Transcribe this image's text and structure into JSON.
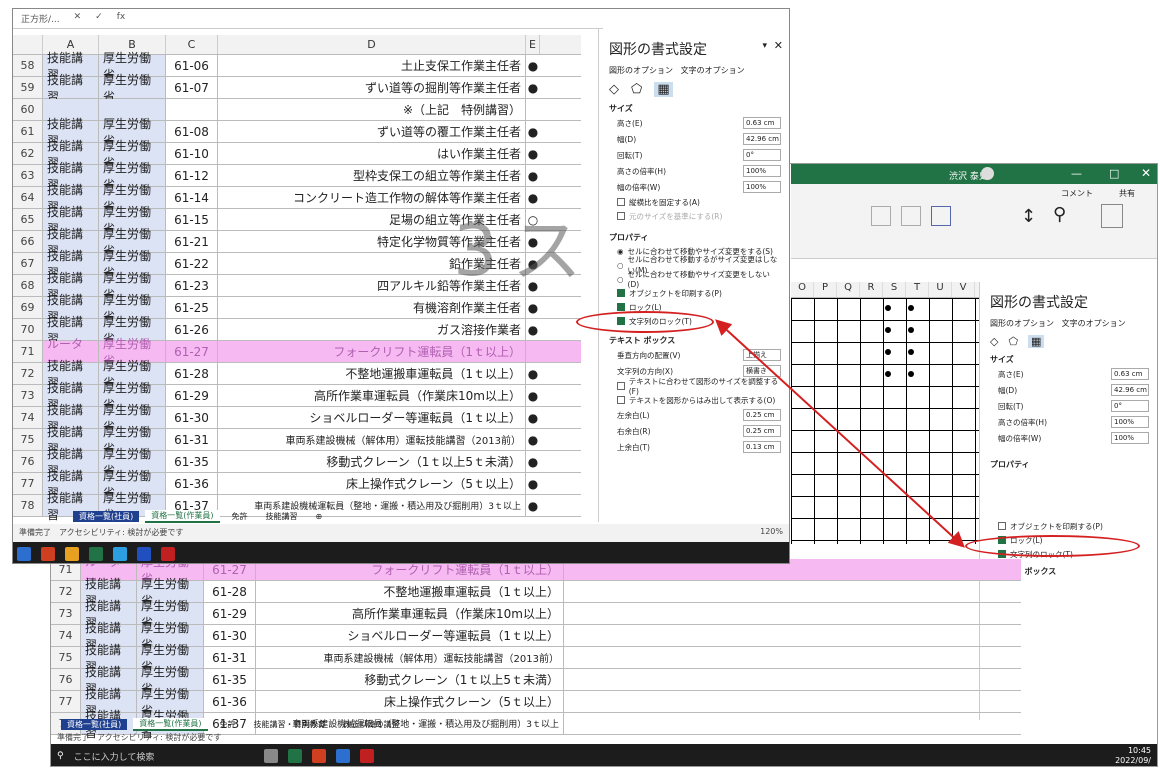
{
  "front_window": {
    "name_box": "正方形/...",
    "fx": "fx",
    "columns": [
      "A",
      "B",
      "C",
      "D",
      "E"
    ],
    "rows": [
      {
        "n": "58",
        "a": "技能講習",
        "b": "厚生労働省",
        "c": "61-06",
        "d": "土止支保工作業主任者",
        "e": "●"
      },
      {
        "n": "59",
        "a": "技能講習",
        "b": "厚生労働省",
        "c": "61-07",
        "d": "ずい道等の掘削等作業主任者",
        "e": "●"
      },
      {
        "n": "60",
        "a": "",
        "b": "",
        "c": "",
        "d": "※（上記　特例講習）",
        "e": ""
      },
      {
        "n": "61",
        "a": "技能講習",
        "b": "厚生労働省",
        "c": "61-08",
        "d": "ずい道等の覆工作業主任者",
        "e": "●"
      },
      {
        "n": "62",
        "a": "技能講習",
        "b": "厚生労働省",
        "c": "61-10",
        "d": "はい作業主任者",
        "e": "●"
      },
      {
        "n": "63",
        "a": "技能講習",
        "b": "厚生労働省",
        "c": "61-12",
        "d": "型枠支保工の組立等作業主任者",
        "e": "●"
      },
      {
        "n": "64",
        "a": "技能講習",
        "b": "厚生労働省",
        "c": "61-14",
        "d": "コンクリート造工作物の解体等作業主任者",
        "e": "●"
      },
      {
        "n": "65",
        "a": "技能講習",
        "b": "厚生労働省",
        "c": "61-15",
        "d": "足場の組立等作業主任者",
        "e": "○"
      },
      {
        "n": "66",
        "a": "技能講習",
        "b": "厚生労働省",
        "c": "61-21",
        "d": "特定化学物質等作業主任者",
        "e": "●"
      },
      {
        "n": "67",
        "a": "技能講習",
        "b": "厚生労働省",
        "c": "61-22",
        "d": "鉛作業主任者",
        "e": "●"
      },
      {
        "n": "68",
        "a": "技能講習",
        "b": "厚生労働省",
        "c": "61-23",
        "d": "四アルキル鉛等作業主任者",
        "e": "●"
      },
      {
        "n": "69",
        "a": "技能講習",
        "b": "厚生労働省",
        "c": "61-25",
        "d": "有機溶剤作業主任者",
        "e": "●"
      },
      {
        "n": "70",
        "a": "技能講習",
        "b": "厚生労働省",
        "c": "61-26",
        "d": "ガス溶接作業者",
        "e": "●"
      },
      {
        "n": "71",
        "a": "ルーター",
        "b": "厚生労働省",
        "c": "61-27",
        "d": "フォークリフト運転員（1ｔ以上）",
        "e": "",
        "pink": true
      },
      {
        "n": "72",
        "a": "技能講習",
        "b": "厚生労働省",
        "c": "61-28",
        "d": "不整地運搬車運転員（1ｔ以上）",
        "e": "●"
      },
      {
        "n": "73",
        "a": "技能講習",
        "b": "厚生労働省",
        "c": "61-29",
        "d": "高所作業車運転員（作業床10m以上）",
        "e": "●"
      },
      {
        "n": "74",
        "a": "技能講習",
        "b": "厚生労働省",
        "c": "61-30",
        "d": "ショベルローダー等運転員（1ｔ以上）",
        "e": "●"
      },
      {
        "n": "75",
        "a": "技能講習",
        "b": "厚生労働省",
        "c": "61-31",
        "d": "車両系建設機械（解体用）運転技能講習（2013前）",
        "e": "●"
      },
      {
        "n": "76",
        "a": "技能講習",
        "b": "厚生労働省",
        "c": "61-35",
        "d": "移動式クレーン（1ｔ以上5ｔ未満）",
        "e": "●"
      },
      {
        "n": "77",
        "a": "技能講習",
        "b": "厚生労働省",
        "c": "61-36",
        "d": "床上操作式クレーン（5ｔ以上）",
        "e": "●"
      },
      {
        "n": "78",
        "a": "技能講習",
        "b": "厚生労働省",
        "c": "61-37",
        "d": "車両系建設機械運転員（整地・運搬・積込用及び掘削用）3ｔ以上",
        "e": "●"
      }
    ],
    "watermark": "3 ス",
    "sheet_tabs": [
      "資格一覧(社員)",
      "資格一覧(作業員)",
      "免許",
      "技能講習",
      "⊕"
    ],
    "status": "準備完了　アクセシビリティ: 検討が必要です",
    "zoom": "120%"
  },
  "front_pane": {
    "title": "図形の書式設定",
    "tab1": "図形のオプション",
    "tab2": "文字のオプション",
    "size_section": "サイズ",
    "size_rows": [
      {
        "label": "高さ(E)",
        "value": "0.63 cm"
      },
      {
        "label": "幅(D)",
        "value": "42.96 cm"
      },
      {
        "label": "回転(T)",
        "value": "0°"
      },
      {
        "label": "高さの倍率(H)",
        "value": "100%"
      },
      {
        "label": "幅の倍率(W)",
        "value": "100%"
      }
    ],
    "lock_ratio": "縦横比を固定する(A)",
    "orig_size": "元のサイズを基準にする(R)",
    "prop_section": "プロパティ",
    "prop_options": [
      "セルに合わせて移動やサイズ変更をする(S)",
      "セルに合わせて移動するがサイズ変更はしない(M)",
      "セルに合わせて移動やサイズ変更をしない(D)"
    ],
    "print_obj": "オブジェクトを印刷する(P)",
    "lock": "ロック(L)",
    "lock_text": "文字列のロック(T)",
    "textbox_section": "テキスト ボックス",
    "tb_rows": [
      {
        "label": "垂直方向の配置(V)",
        "value": "上揃え"
      },
      {
        "label": "文字列の方向(X)",
        "value": "横書き"
      }
    ],
    "tb_chk1": "テキストに合わせて図形のサイズを調整する(F)",
    "tb_chk2": "テキストを図形からはみ出して表示する(O)",
    "margins": [
      {
        "label": "左余白(L)",
        "value": "0.25 cm"
      },
      {
        "label": "右余白(R)",
        "value": "0.25 cm"
      },
      {
        "label": "上余白(T)",
        "value": "0.13 cm"
      }
    ]
  },
  "back_window": {
    "user": "渋沢 泰史",
    "share": "共有",
    "comment": "コメント",
    "columns": [
      "O",
      "P",
      "Q",
      "R",
      "S",
      "T",
      "U",
      "V"
    ],
    "rows": [
      {
        "n": "71",
        "a": "ルーター",
        "b": "厚生労働省",
        "c": "61-27",
        "d": "フォークリフト運転員（1ｔ以上）",
        "pink": true
      },
      {
        "n": "72",
        "a": "技能講習",
        "b": "厚生労働省",
        "c": "61-28",
        "d": "不整地運搬車運転員（1ｔ以上）"
      },
      {
        "n": "73",
        "a": "技能講習",
        "b": "厚生労働省",
        "c": "61-29",
        "d": "高所作業車運転員（作業床10m以上）"
      },
      {
        "n": "74",
        "a": "技能講習",
        "b": "厚生労働省",
        "c": "61-30",
        "d": "ショベルローダー等運転員（1ｔ以上）"
      },
      {
        "n": "75",
        "a": "技能講習",
        "b": "厚生労働省",
        "c": "61-31",
        "d": "車両系建設機械（解体用）運転技能講習（2013前）"
      },
      {
        "n": "76",
        "a": "技能講習",
        "b": "厚生労働省",
        "c": "61-35",
        "d": "移動式クレーン（1ｔ以上5ｔ未満）"
      },
      {
        "n": "77",
        "a": "技能講習",
        "b": "厚生労働省",
        "c": "61-36",
        "d": "床上操作式クレーン（5ｔ以上）"
      },
      {
        "n": "78",
        "a": "技能講習",
        "b": "厚生労働省",
        "c": "61-37",
        "d": "車両系建設機械運転員（整地・運搬・積込用及び掘削用）3ｔ以上"
      }
    ],
    "sheet_tabs": [
      "資格一覧(社員)",
      "資格一覧(作業員)",
      "免許",
      "技能講習・特別教育",
      "改正以降の講習"
    ],
    "status": "準備完了　アクセシビリティ: 検討が必要です",
    "search": "ここに入力して検索",
    "clock_time": "10:45",
    "clock_date": "2022/09/"
  },
  "back_pane": {
    "title": "図形の書式設定",
    "tab1": "図形のオプション",
    "tab2": "文字のオプション",
    "size_section": "サイズ",
    "size_rows": [
      {
        "label": "高さ(E)",
        "value": "0.63 cm"
      },
      {
        "label": "幅(D)",
        "value": "42.96 cm"
      },
      {
        "label": "回転(T)",
        "value": "0°"
      },
      {
        "label": "高さの倍率(H)",
        "value": "100%"
      },
      {
        "label": "幅の倍率(W)",
        "value": "100%"
      }
    ],
    "prop_section": "プロパティ",
    "print_obj": "オブジェクトを印刷する(P)",
    "lock": "ロック(L)",
    "lock_text": "文字列のロック(T)",
    "textbox_section": "テキスト ボックス"
  }
}
